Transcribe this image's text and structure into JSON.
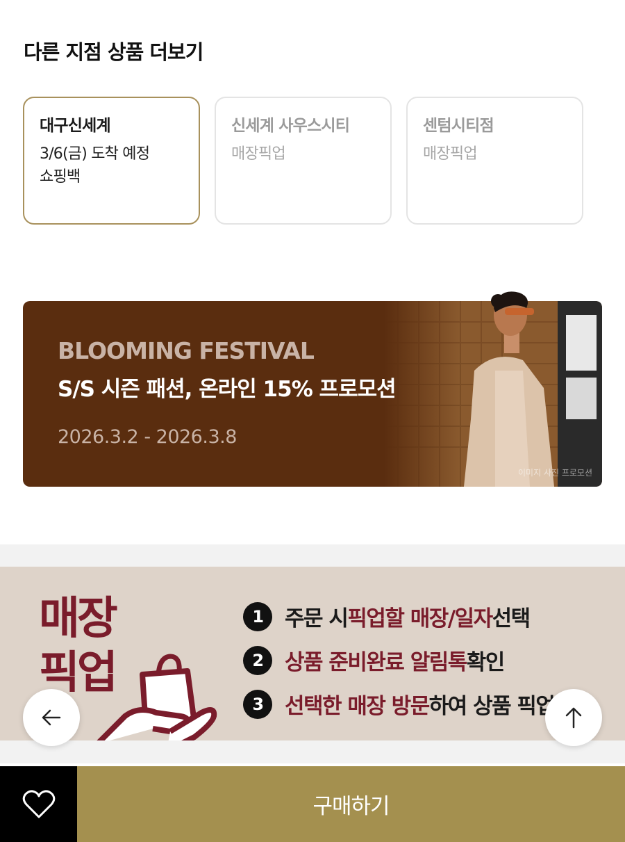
{
  "section": {
    "title": "다른 지점 상품 더보기"
  },
  "stores": [
    {
      "name": "대구신세계",
      "line1": "3/6(금) 도착 예정",
      "line2": "쇼핑백",
      "selected": true
    },
    {
      "name": "신세계 사우스시티",
      "line1": "매장픽업",
      "line2": "",
      "selected": false
    },
    {
      "name": "센텀시티점",
      "line1": "매장픽업",
      "line2": "",
      "selected": false
    }
  ],
  "banner": {
    "eyebrow": "BLOOMING FESTIVAL",
    "headline": "S/S 시즌 패션, 온라인 15% 프로모션",
    "dates": "2026.3.2 - 2026.3.8",
    "credit": "이미지 사진 프로모션"
  },
  "pickup": {
    "title_line1": "매장",
    "title_line2": "픽업",
    "steps": [
      {
        "num": "1",
        "pre": "주문 시 ",
        "hl": "픽업할 매장/일자",
        "post": " 선택"
      },
      {
        "num": "2",
        "pre": "",
        "hl": "상품 준비완료 알림톡",
        "post": " 확인"
      },
      {
        "num": "3",
        "pre": "",
        "hl": "선택한 매장 방문",
        "post": "하여 상품 픽업"
      }
    ]
  },
  "fabs": {
    "back_icon": "arrow-left-icon",
    "top_icon": "arrow-up-icon"
  },
  "bottom_bar": {
    "wish_icon": "heart-icon",
    "buy_label": "구매하기"
  },
  "colors": {
    "accent_gold": "#a4904f",
    "banner_brown": "#5a2d0f",
    "pickup_red": "#7a1c2b"
  }
}
